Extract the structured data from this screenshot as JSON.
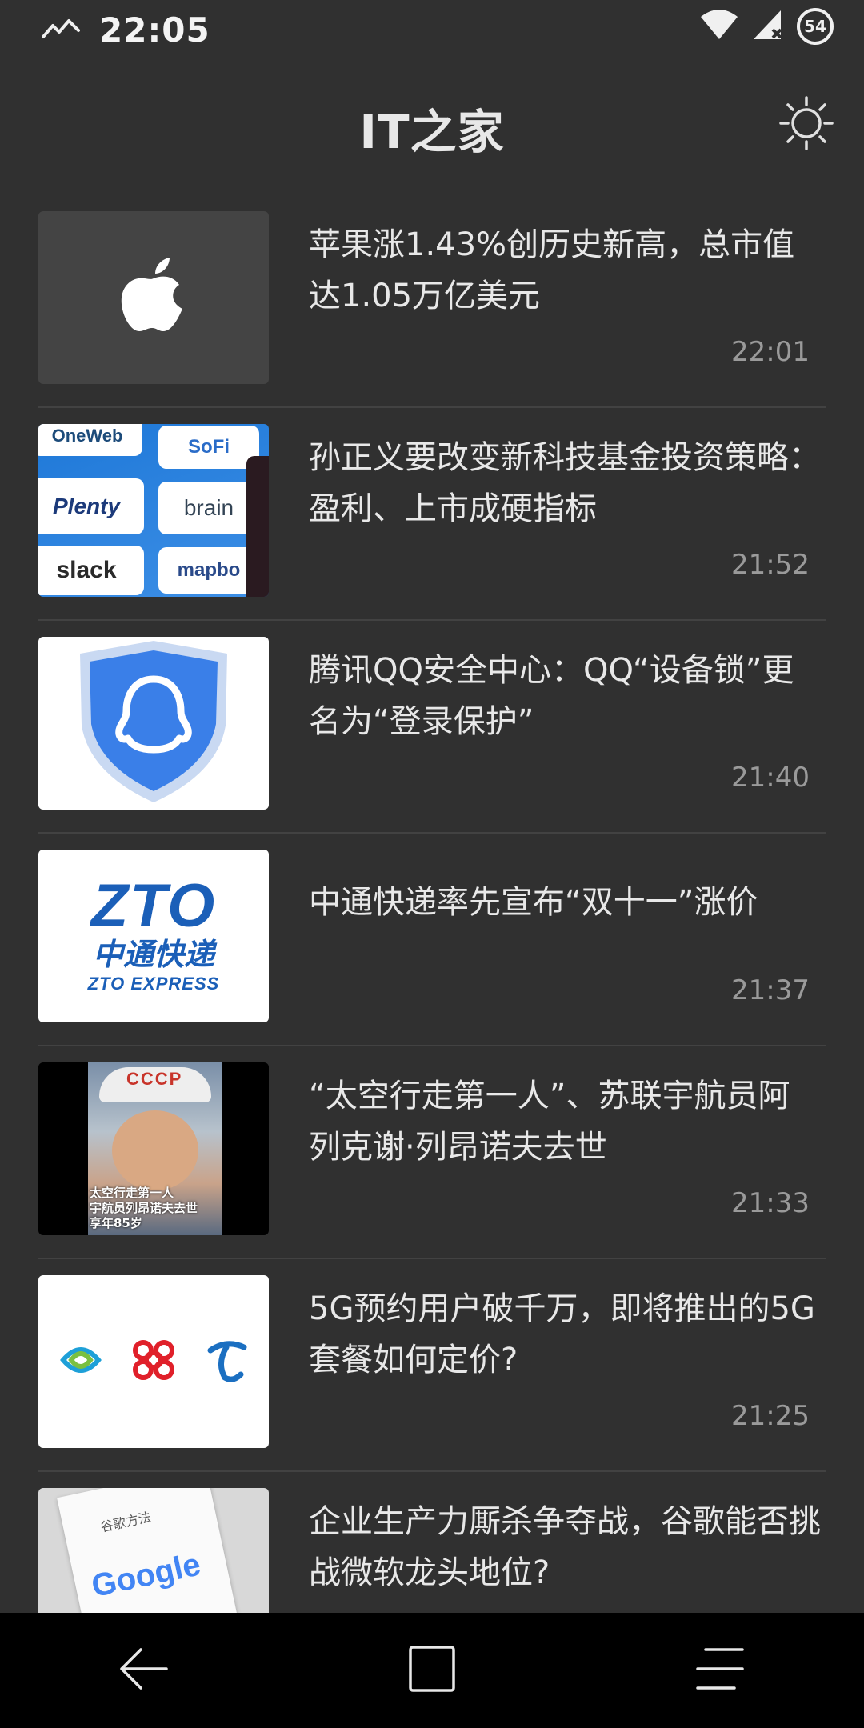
{
  "status_bar": {
    "time": "22:05",
    "battery": "54",
    "icons": [
      "signal-trend-icon",
      "wifi-icon",
      "cellular-signal-icon",
      "battery-icon"
    ]
  },
  "header": {
    "title": "IT之家",
    "theme_icon": "sun-icon"
  },
  "news": [
    {
      "title": "苹果涨1.43%创历史新高，总市值达1.05万亿美元",
      "time": "22:01",
      "thumb": "apple-logo"
    },
    {
      "title": "孙正义要改变新科技基金投资策略： 盈利、上市成硬指标",
      "time": "21:52",
      "thumb": "softbank-portfolio"
    },
    {
      "title": "腾讯QQ安全中心：QQ“设备锁”更名为“登录保护”",
      "time": "21:40",
      "thumb": "qq-security-shield"
    },
    {
      "title": "中通快递率先宣布“双十一”涨价",
      "time": "21:37",
      "thumb": "zto-logo"
    },
    {
      "title": "“太空行走第一人”、苏联宇航员阿列克谢·列昂诺夫去世",
      "time": "21:33",
      "thumb": "cosmonaut-photo"
    },
    {
      "title": "5G预约用户破千万，即将推出的5G套餐如何定价?",
      "time": "21:25",
      "thumb": "carrier-logos"
    },
    {
      "title": "企业生产力厮杀争夺战，谷歌能否挑战微软龙头地位?",
      "time": "",
      "thumb": "google-book"
    }
  ],
  "thumb_text": {
    "oneweb": "OneWeb",
    "sofi": "SoFi",
    "plenty": "Plenty",
    "brain": "brain",
    "slack": "slack",
    "mapbox": "mapbo",
    "zto_mark": "ZTO",
    "zto_cn": "中通快递",
    "zto_en": "ZTO EXPRESS",
    "cccp": "CCCP",
    "leonov_caption1": "太空行走第一人",
    "leonov_caption2": "宇航员列昂诺夫去世",
    "leonov_caption3": "享年85岁",
    "book_title": "谷歌方法",
    "book_logo": "Google"
  },
  "nav": {
    "back_icon": "back-arrow-icon",
    "home_icon": "home-square-icon",
    "menu_icon": "menu-lines-icon"
  },
  "colors": {
    "background": "#303030",
    "text": "#e8e8e8",
    "time": "#9a9a9a",
    "divider": "#424242",
    "nav": "#000000"
  }
}
